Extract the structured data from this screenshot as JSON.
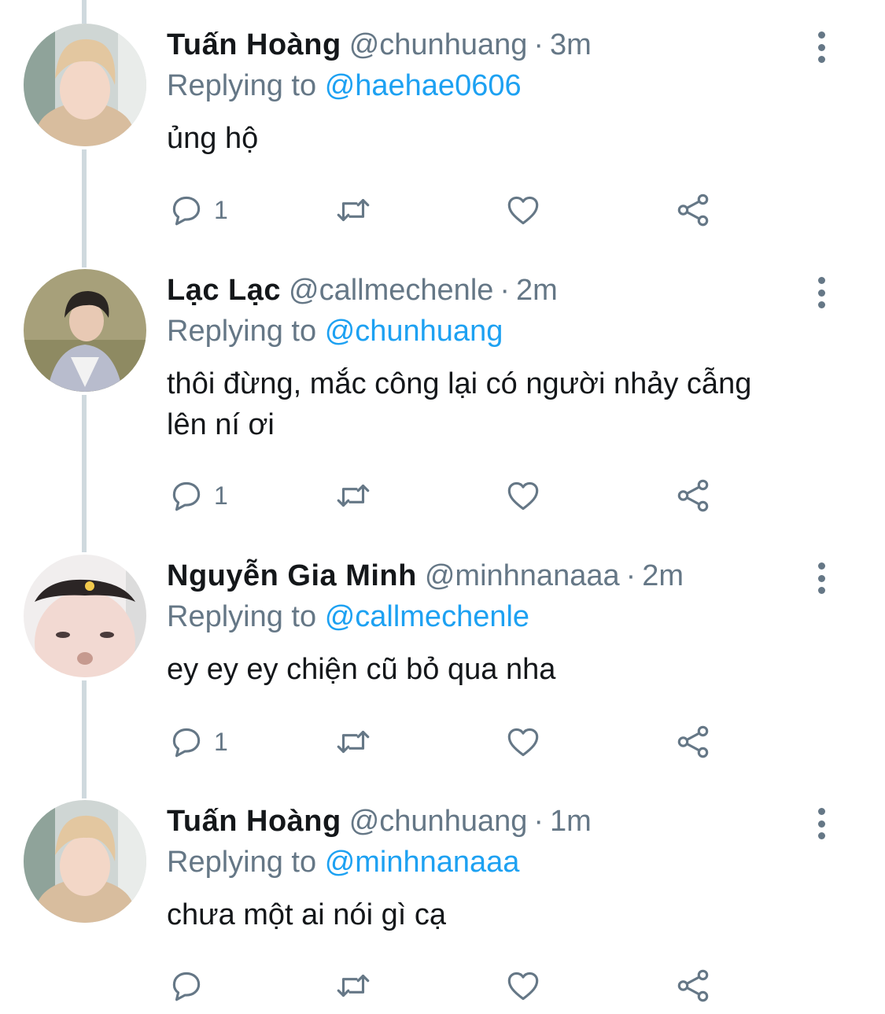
{
  "tweets": [
    {
      "name": "Tuấn Hoàng",
      "handle": "@chunhuang",
      "time": "3m",
      "replying_label": "Replying to",
      "replying_to": "@haehae0606",
      "text": "ủng hộ",
      "reply_count": "1"
    },
    {
      "name": "Lạc Lạc",
      "handle": "@callmechenle",
      "time": "2m",
      "replying_label": "Replying to",
      "replying_to": "@chunhuang",
      "text": "thôi đừng, mắc công lại có người nhảy cẫng lên ní ơi",
      "reply_count": "1"
    },
    {
      "name": "Nguyễn Gia Minh",
      "handle": "@minhnanaaa",
      "time": "2m",
      "replying_label": "Replying to",
      "replying_to": "@callmechenle",
      "text": "ey ey ey chiện cũ bỏ qua nha",
      "reply_count": "1"
    },
    {
      "name": "Tuấn Hoàng",
      "handle": "@chunhuang",
      "time": "1m",
      "replying_label": "Replying to",
      "replying_to": "@minhnanaaa",
      "text": "chưa một ai nói gì cạ",
      "reply_count": ""
    }
  ],
  "separator": "·",
  "icons": {
    "reply": "reply-icon",
    "retweet": "retweet-icon",
    "like": "heart-icon",
    "share": "share-icon",
    "more": "more-options-icon"
  },
  "colors": {
    "text": "#14171a",
    "secondary": "#657786",
    "link": "#1da1f2",
    "thread_line": "#cfd9de"
  }
}
